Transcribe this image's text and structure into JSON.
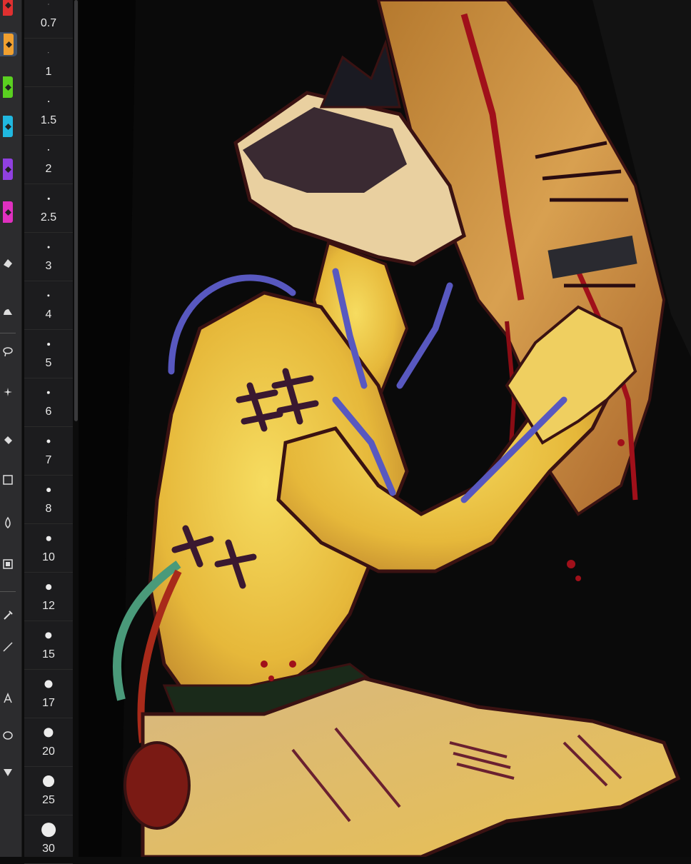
{
  "toolbar": {
    "tools": [
      {
        "name": "red-brush-tool",
        "color": "#e03030"
      },
      {
        "name": "orange-brush-tool",
        "color": "#f0a030",
        "active": true
      },
      {
        "name": "green-brush-tool",
        "color": "#5ad020"
      },
      {
        "name": "cyan-brush-tool",
        "color": "#20b8e0"
      },
      {
        "name": "purple-brush-tool",
        "color": "#9040e0"
      },
      {
        "name": "magenta-brush-tool",
        "color": "#e030c0"
      }
    ],
    "icons": [
      "eraser-icon",
      "smudge-icon",
      "lasso-icon",
      "magic-wand-icon",
      "fill-icon",
      "rectangle-icon",
      "blur-icon",
      "transform-icon",
      "eyedropper-icon",
      "line-icon",
      "text-icon",
      "ellipse-icon",
      "arrow-icon"
    ]
  },
  "brush_sizes": {
    "items": [
      {
        "label": "0.7",
        "dot": 1
      },
      {
        "label": "1",
        "dot": 1.3
      },
      {
        "label": "1.5",
        "dot": 1.6
      },
      {
        "label": "2",
        "dot": 2
      },
      {
        "label": "2.5",
        "dot": 2.3
      },
      {
        "label": "3",
        "dot": 2.6
      },
      {
        "label": "4",
        "dot": 3
      },
      {
        "label": "5",
        "dot": 3.4
      },
      {
        "label": "6",
        "dot": 4
      },
      {
        "label": "7",
        "dot": 4.6
      },
      {
        "label": "8",
        "dot": 5.2
      },
      {
        "label": "10",
        "dot": 6
      },
      {
        "label": "12",
        "dot": 7
      },
      {
        "label": "15",
        "dot": 8.5
      },
      {
        "label": "17",
        "dot": 10
      },
      {
        "label": "20",
        "dot": 12
      },
      {
        "label": "25",
        "dot": 14.5
      },
      {
        "label": "30",
        "dot": 18
      }
    ]
  },
  "colors": {
    "toolbar_bg": "#2c2c2e",
    "size_panel_bg": "#1c1c1e",
    "canvas_bg": "#0a0a0a",
    "skin": "#e8c040",
    "outline": "#5a1a28",
    "blood": "#b01018",
    "tube": "#5858c0"
  }
}
